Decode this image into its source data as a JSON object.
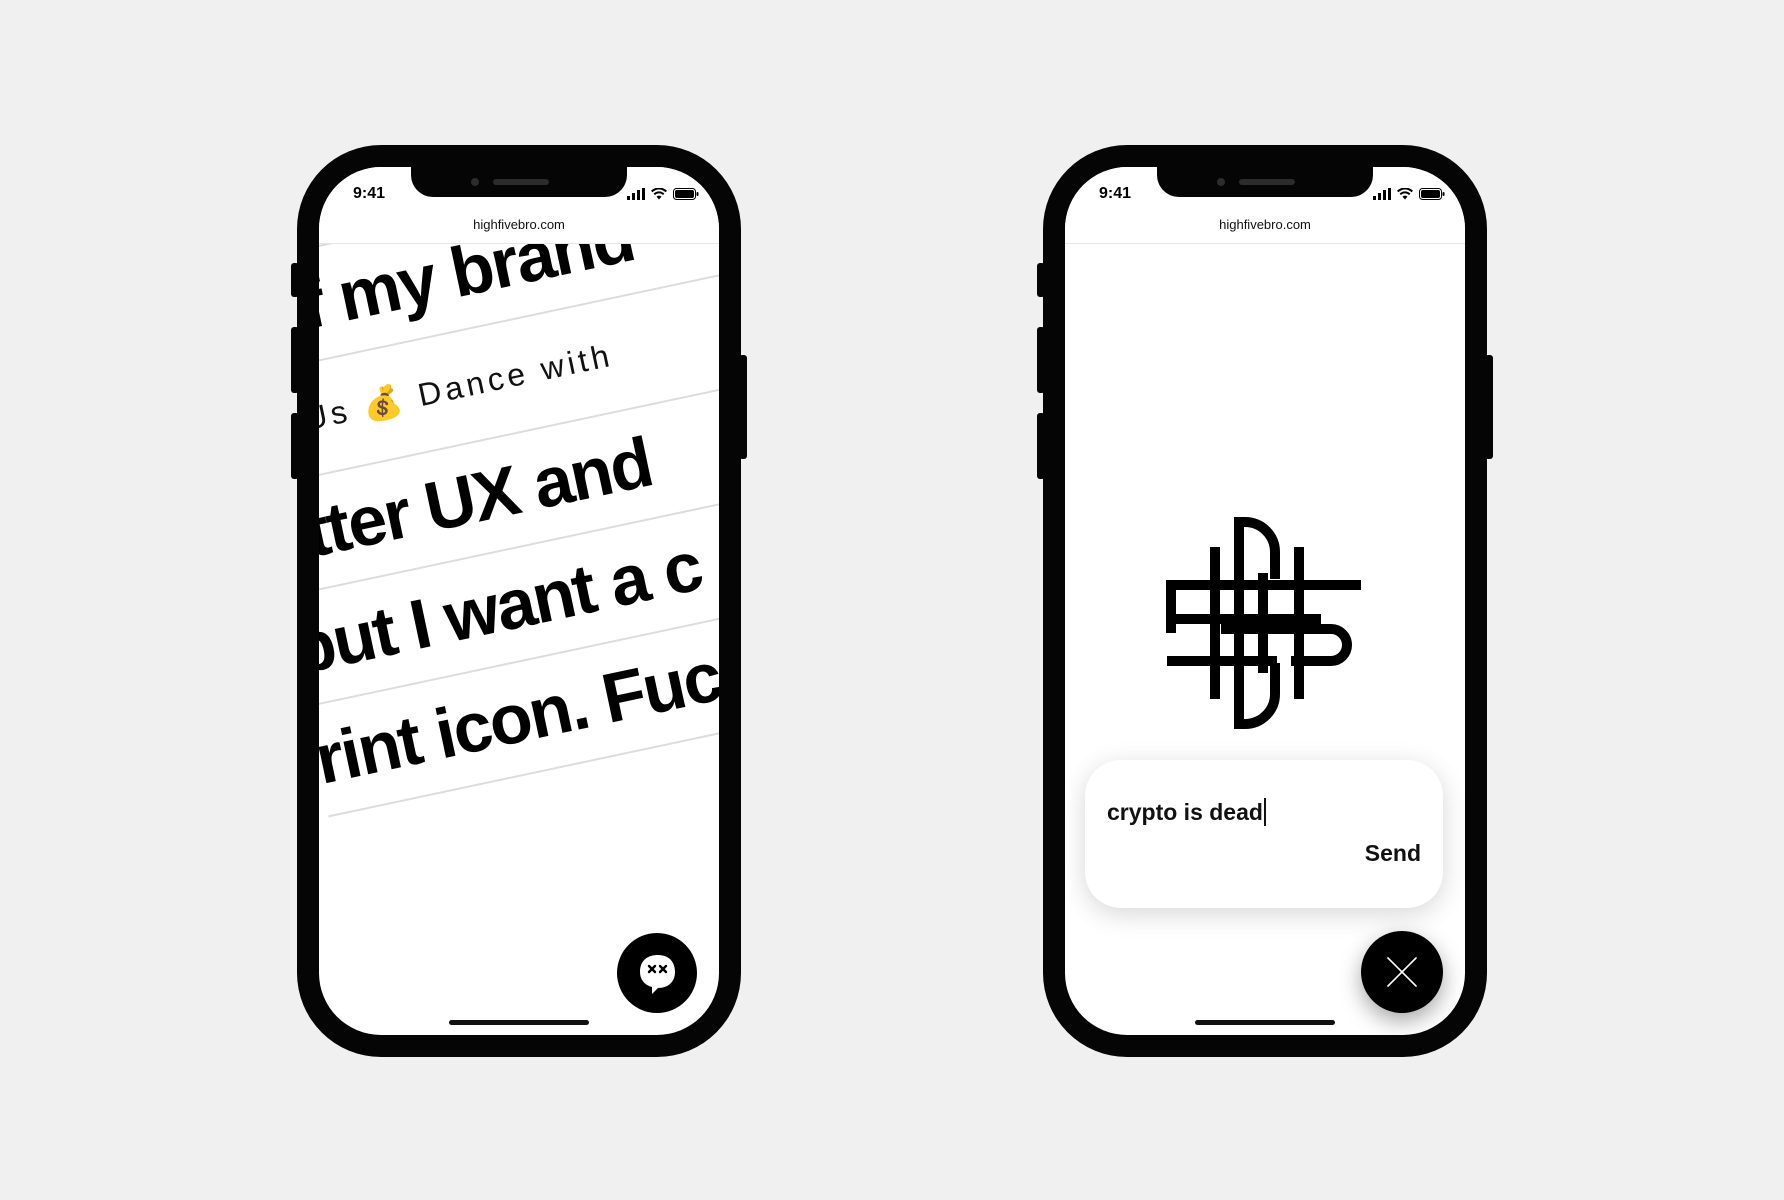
{
  "left_phone": {
    "status": {
      "time": "9:41"
    },
    "browser": {
      "url": "highfivebro.com"
    },
    "ticker": {
      "lines": [
        "t of my brand",
        "ith Us 💰  Dance with",
        "etter UX and",
        "but I want a c",
        "rint icon. Fuc"
      ]
    },
    "chat_button": {
      "icon": "chat-bubble-dead-face-icon"
    }
  },
  "right_phone": {
    "status": {
      "time": "9:41"
    },
    "browser": {
      "url": "highfivebro.com"
    },
    "logo": {
      "icon": "interlaced-b-monogram-logo"
    },
    "message_input": {
      "value": "crypto is dead"
    },
    "send_label": "Send",
    "close_button": {
      "icon": "close-icon"
    }
  },
  "colors": {
    "background": "#f0f0f0",
    "phone_frame": "#050505",
    "screen": "#ffffff",
    "text": "#111111"
  }
}
